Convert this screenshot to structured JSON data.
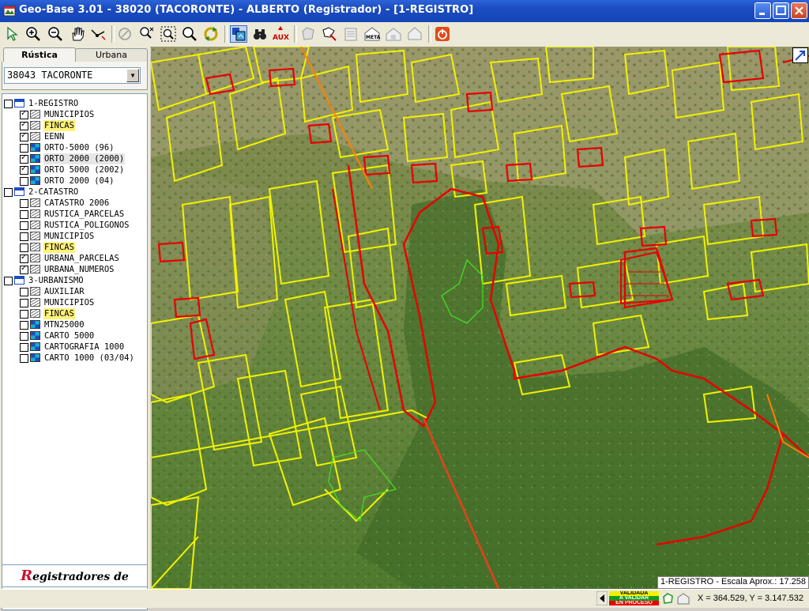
{
  "window": {
    "title": "Geo-Base  3.01  -  38020 (TACORONTE)  -  ALBERTO  (Registrador) - [1-REGISTRO]"
  },
  "toolbar": {
    "buttons": [
      "select-arrow",
      "zoom-in",
      "zoom-out",
      "pan-hand",
      "measure",
      "info",
      "zoom-window",
      "zoom-extent",
      "zoom-search",
      "refresh",
      "layers",
      "binoculars",
      "aux",
      "shape",
      "edit",
      "register",
      "meta",
      "building",
      "house",
      "power"
    ],
    "aux_label": "AUX",
    "meta_label": "META"
  },
  "left_panel": {
    "tabs": [
      {
        "label": "Rústica",
        "active": true
      },
      {
        "label": "Urbana",
        "active": false
      }
    ],
    "municipality_select": "38043 TACORONTE",
    "tree": [
      {
        "label": "1-REGISTRO",
        "type": "group",
        "checked": false,
        "indent": 0
      },
      {
        "label": "MUNICIPIOS",
        "type": "vector",
        "checked": true,
        "indent": 1
      },
      {
        "label": "FINCAS",
        "type": "vector",
        "checked": true,
        "indent": 1,
        "highlight": "yellow"
      },
      {
        "label": "EENN",
        "type": "vector",
        "checked": true,
        "indent": 1
      },
      {
        "label": "ORTO-5000 (96)",
        "type": "raster",
        "checked": false,
        "indent": 1
      },
      {
        "label": "ORTO 2000 (2000)",
        "type": "raster",
        "checked": true,
        "indent": 1,
        "highlight": "gray"
      },
      {
        "label": "ORTO 5000 (2002)",
        "type": "raster",
        "checked": true,
        "indent": 1
      },
      {
        "label": "ORTO 2000 (04)",
        "type": "raster",
        "checked": false,
        "indent": 1
      },
      {
        "label": "2-CATASTRO",
        "type": "group",
        "checked": false,
        "indent": 0
      },
      {
        "label": "CATASTRO 2006",
        "type": "vector",
        "checked": false,
        "indent": 1
      },
      {
        "label": "RUSTICA_PARCELAS",
        "type": "vector",
        "checked": false,
        "indent": 1
      },
      {
        "label": "RUSTICA_POLIGONOS",
        "type": "vector",
        "checked": false,
        "indent": 1
      },
      {
        "label": "MUNICIPIOS",
        "type": "vector",
        "checked": false,
        "indent": 1
      },
      {
        "label": "FINCAS",
        "type": "vector",
        "checked": false,
        "indent": 1,
        "highlight": "yellow"
      },
      {
        "label": "URBANA_PARCELAS",
        "type": "vector",
        "checked": true,
        "indent": 1
      },
      {
        "label": "URBANA_NUMEROS",
        "type": "vector",
        "checked": true,
        "indent": 1
      },
      {
        "label": "3-URBANISMO",
        "type": "group",
        "checked": false,
        "indent": 0
      },
      {
        "label": "AUXILIAR",
        "type": "vector",
        "checked": false,
        "indent": 1
      },
      {
        "label": "MUNICIPIOS",
        "type": "vector",
        "checked": false,
        "indent": 1
      },
      {
        "label": "FINCAS",
        "type": "vector",
        "checked": false,
        "indent": 1,
        "highlight": "yellow"
      },
      {
        "label": "MTN25000",
        "type": "raster",
        "checked": false,
        "indent": 1
      },
      {
        "label": "CARTO 5000",
        "type": "raster",
        "checked": false,
        "indent": 1
      },
      {
        "label": "CARTOGRAFIA 1000",
        "type": "raster",
        "checked": false,
        "indent": 1
      },
      {
        "label": "CARTO 1000 (03/04)",
        "type": "raster",
        "checked": false,
        "indent": 1
      }
    ],
    "logo_text": "Registradores de España"
  },
  "map": {
    "scale_label": "1-REGISTRO - Escala Aprox.: 17.258",
    "colors": {
      "parcel_yellow": "#f2f200",
      "parcel_red": "#e80000",
      "boundary_green": "#44dd22",
      "orange_line": "#ff8000",
      "ortho_green": "#6d8a3c"
    }
  },
  "status": {
    "legend": [
      "VALIDADA",
      "A VALIDAR",
      "EN PROCESO"
    ],
    "coords": "X = 364.529, Y = 3.147.532"
  }
}
